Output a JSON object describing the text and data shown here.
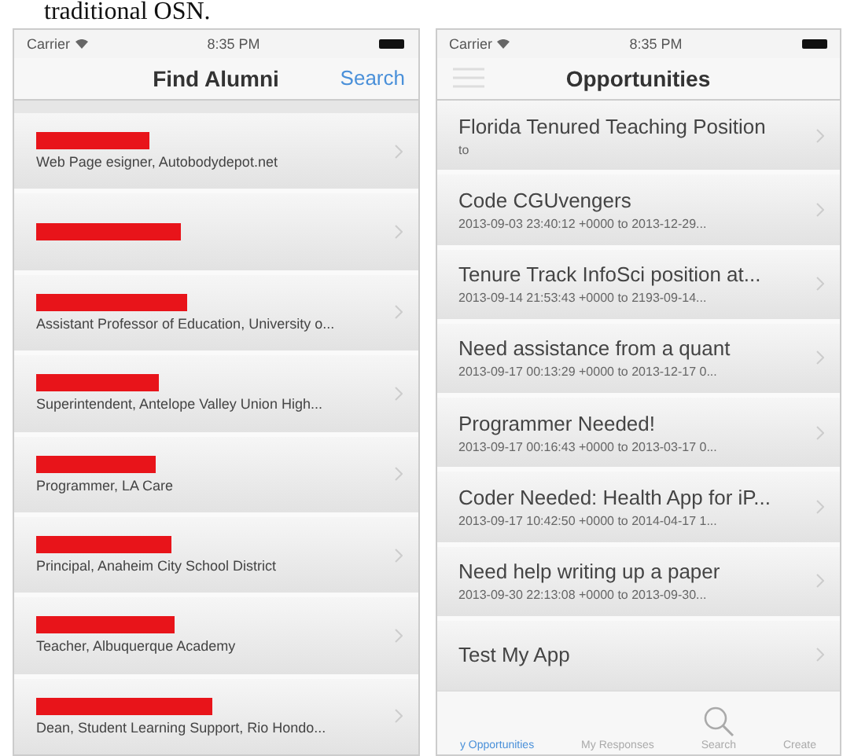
{
  "caption": "traditional OSN.",
  "screens": [
    {
      "status": {
        "carrier": "Carrier",
        "time": "8:35 PM"
      },
      "title": "Find Alumni",
      "nav_action": "Search",
      "rows": [
        {
          "kind": "redacted",
          "subtitle": "Web Page esigner, Autobodydepot.net"
        },
        {
          "kind": "redacted"
        },
        {
          "kind": "redacted",
          "subtitle": "Assistant Professor of Education, University o..."
        },
        {
          "kind": "redacted",
          "subtitle": "Superintendent, Antelope Valley Union High..."
        },
        {
          "kind": "redacted",
          "subtitle": "Programmer, LA Care"
        },
        {
          "kind": "redacted",
          "subtitle": "Principal, Anaheim City School District"
        },
        {
          "kind": "redacted",
          "subtitle": "Teacher, Albuquerque Academy"
        },
        {
          "kind": "redacted",
          "subtitle": "Dean, Student Learning Support, Rio Hondo..."
        }
      ]
    },
    {
      "status": {
        "carrier": "Carrier",
        "time": "8:35 PM"
      },
      "title": "Opportunities",
      "menu": true,
      "rows": [
        {
          "kind": "text",
          "title": "Florida Tenured Teaching Position",
          "subtitle": "to"
        },
        {
          "kind": "text",
          "title": "Code CGUvengers",
          "subtitle": "2013-09-03 23:40:12 +0000 to 2013-12-29..."
        },
        {
          "kind": "text",
          "title": "Tenure Track InfoSci position at...",
          "subtitle": "2013-09-14 21:53:43 +0000 to 2193-09-14..."
        },
        {
          "kind": "text",
          "title": "Need assistance from a quant",
          "subtitle": "2013-09-17 00:13:29 +0000 to 2013-12-17 0..."
        },
        {
          "kind": "text",
          "title": "Programmer Needed!",
          "subtitle": "2013-09-17 00:16:43 +0000 to 2013-03-17 0..."
        },
        {
          "kind": "text",
          "title": "Coder Needed: Health App for iP...",
          "subtitle": "2013-09-17 10:42:50 +0000 to 2014-04-17 1..."
        },
        {
          "kind": "text",
          "title": "Need help writing up a paper",
          "subtitle": "2013-09-30 22:13:08 +0000 to 2013-09-30..."
        },
        {
          "kind": "text",
          "title": "Test My App"
        }
      ],
      "tabs": [
        {
          "label": "y Opportunities",
          "selected": true,
          "kind": "text"
        },
        {
          "label": "My Responses",
          "selected": false,
          "kind": "text"
        },
        {
          "label": "Search",
          "selected": false,
          "kind": "search"
        },
        {
          "label": "Create",
          "selected": false,
          "kind": "text"
        }
      ]
    }
  ]
}
